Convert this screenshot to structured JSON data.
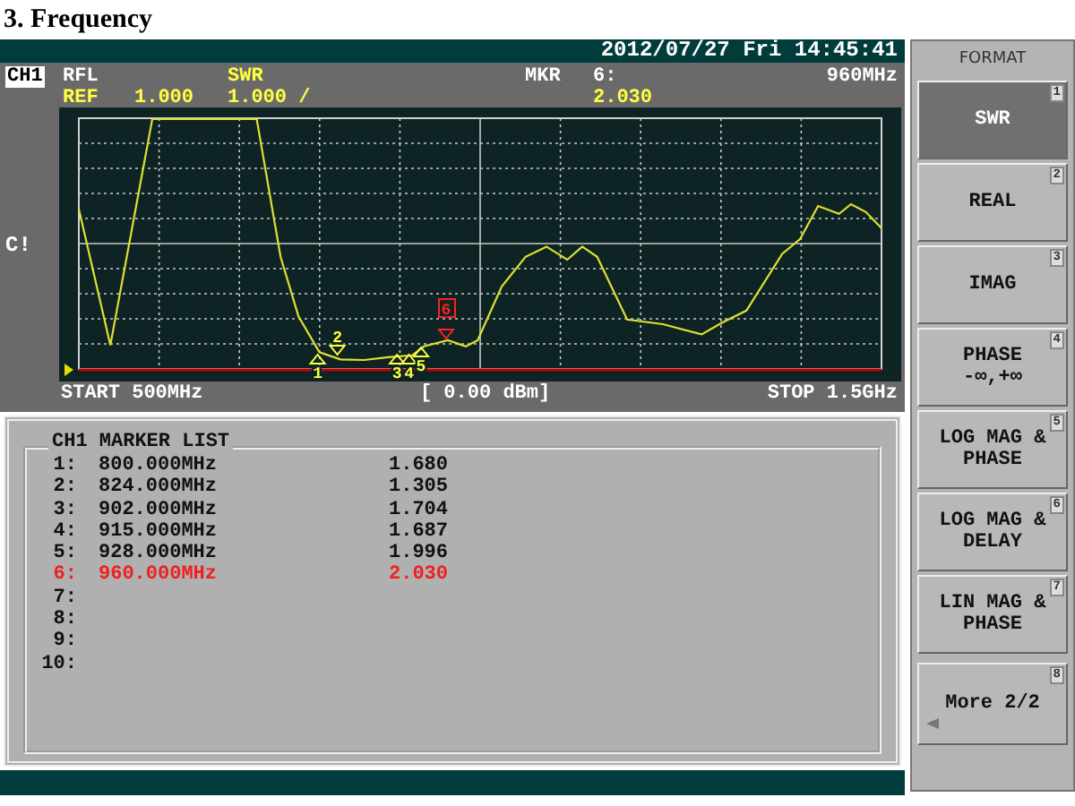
{
  "heading": "3.  Frequency",
  "datetime": "2012/07/27 Fri 14:45:41",
  "header": {
    "channel": "CH1",
    "measurement": "RFL",
    "format": "SWR",
    "marker_label": "MKR",
    "marker_id": "6:",
    "marker_freq": "960MHz",
    "ref_label": "REF",
    "ref_value": "1.000",
    "scale": "1.000 /",
    "marker_value": "2.030"
  },
  "graph": {
    "side_label": "C!",
    "start": "START 500MHz",
    "power": "[ 0.00 dBm]",
    "stop": "STOP 1.5GHz",
    "markers": [
      {
        "label": "1",
        "active": false
      },
      {
        "label": "2",
        "active": false
      },
      {
        "label": "3",
        "active": false
      },
      {
        "label": "4",
        "active": false
      },
      {
        "label": "5",
        "active": false
      },
      {
        "label": "6",
        "active": true
      }
    ]
  },
  "marker_list": {
    "title": "CH1 MARKER LIST",
    "rows": [
      {
        "index": "1:",
        "frequency": "800.000MHz",
        "value": "1.680",
        "active": false
      },
      {
        "index": "2:",
        "frequency": "824.000MHz",
        "value": "1.305",
        "active": false
      },
      {
        "index": "3:",
        "frequency": "902.000MHz",
        "value": "1.704",
        "active": false
      },
      {
        "index": "4:",
        "frequency": "915.000MHz",
        "value": "1.687",
        "active": false
      },
      {
        "index": "5:",
        "frequency": "928.000MHz",
        "value": "1.996",
        "active": false
      },
      {
        "index": "6:",
        "frequency": "960.000MHz",
        "value": "2.030",
        "active": true
      },
      {
        "index": "7:",
        "active": false
      },
      {
        "index": "8:",
        "active": false
      },
      {
        "index": "9:",
        "active": false
      },
      {
        "index": "10:",
        "active": false
      }
    ]
  },
  "softkeys": {
    "title": "FORMAT",
    "keys": [
      {
        "kind": "plain",
        "lines": [
          "SWR"
        ],
        "number": "1",
        "selected": true
      },
      {
        "kind": "plain",
        "lines": [
          "REAL"
        ],
        "number": "2",
        "selected": false
      },
      {
        "kind": "plain",
        "lines": [
          "IMAG"
        ],
        "number": "3",
        "selected": false
      },
      {
        "kind": "plain",
        "lines": [
          "PHASE",
          "-∞,+∞"
        ],
        "number": "4",
        "selected": false
      },
      {
        "kind": "plain",
        "lines": [
          "LOG MAG &",
          "PHASE"
        ],
        "number": "5",
        "selected": false
      },
      {
        "kind": "plain",
        "lines": [
          "LOG MAG &",
          "DELAY"
        ],
        "number": "6",
        "selected": false
      },
      {
        "kind": "plain",
        "lines": [
          "LIN MAG &",
          "PHASE"
        ],
        "number": "7",
        "selected": false
      },
      {
        "kind": "more",
        "lines": [
          "More 2/2"
        ],
        "number": "8",
        "selected": false
      }
    ]
  }
}
